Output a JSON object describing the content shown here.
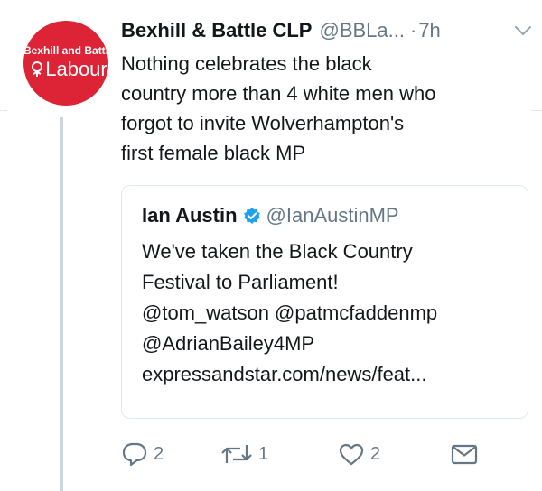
{
  "avatar": {
    "line1": "Bexhill and Battle",
    "line2": "Labour",
    "brand_color": "#dc2436"
  },
  "tweet": {
    "display_name": "Bexhill & Battle CLP",
    "handle": "@BBLa...",
    "separator": "·",
    "time": "7h",
    "text_lines": [
      "Nothing celebrates the black",
      "country more than 4 white men who",
      "forgot to invite Wolverhampton's",
      "first female black MP"
    ]
  },
  "quote": {
    "display_name": "Ian Austin",
    "verified": true,
    "handle": "@IanAustinMP",
    "text_lines": [
      "We've taken the Black Country",
      "Festival to Parliament!",
      "@tom_watson @patmcfaddenmp",
      "@AdrianBailey4MP",
      "expressandstar.com/news/feat..."
    ]
  },
  "actions": {
    "reply_count": "2",
    "retweet_count": "1",
    "like_count": "2",
    "icons": [
      "reply-icon",
      "retweet-icon",
      "like-icon",
      "direct-message-icon"
    ]
  },
  "colors": {
    "text": "#14171a",
    "muted": "#657786",
    "border": "#e1e8ed",
    "thread_line": "#ccd6dd",
    "verified": "#1da1f2"
  }
}
